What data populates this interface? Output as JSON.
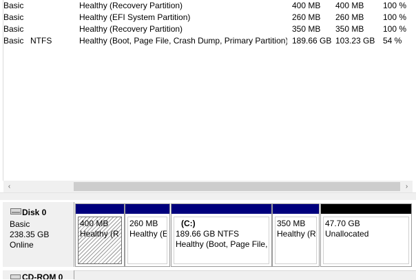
{
  "volumes": [
    {
      "layout": "Basic",
      "fs": "",
      "status": "Healthy (Recovery Partition)",
      "capacity": "400 MB",
      "free": "400 MB",
      "pct": "100 %"
    },
    {
      "layout": "Basic",
      "fs": "",
      "status": "Healthy (EFI System Partition)",
      "capacity": "260 MB",
      "free": "260 MB",
      "pct": "100 %"
    },
    {
      "layout": "Basic",
      "fs": "",
      "status": "Healthy (Recovery Partition)",
      "capacity": "350 MB",
      "free": "350 MB",
      "pct": "100 %"
    },
    {
      "layout": "Basic",
      "fs": "NTFS",
      "status": "Healthy (Boot, Page File, Crash Dump, Primary Partition)",
      "capacity": "189.66 GB",
      "free": "103.23 GB",
      "pct": "54 %"
    }
  ],
  "scroll": {
    "left_icon": "chevron-left-icon",
    "right_icon": "chevron-right-icon",
    "left_glyph": "‹",
    "right_glyph": "›"
  },
  "disk0": {
    "name": "Disk 0",
    "type": "Basic",
    "size": "238.35 GB",
    "status": "Online",
    "partitions": [
      {
        "line1": "400 MB",
        "line2": "Healthy (R",
        "line3": "",
        "selected": true
      },
      {
        "line1": "260 MB",
        "line2": "Healthy (E",
        "line3": ""
      },
      {
        "line1": "(C:)",
        "line2": "189.66 GB NTFS",
        "line3": "Healthy (Boot, Page File,"
      },
      {
        "line1": "350 MB",
        "line2": "Healthy (R",
        "line3": ""
      },
      {
        "line1": "47.70 GB",
        "line2": "Unallocated",
        "line3": "",
        "unallocated": true
      }
    ]
  },
  "cdrom": {
    "name": "CD-ROM 0"
  },
  "colors": {
    "primary_bar": "#00007d",
    "unallocated_bar": "#000000"
  }
}
